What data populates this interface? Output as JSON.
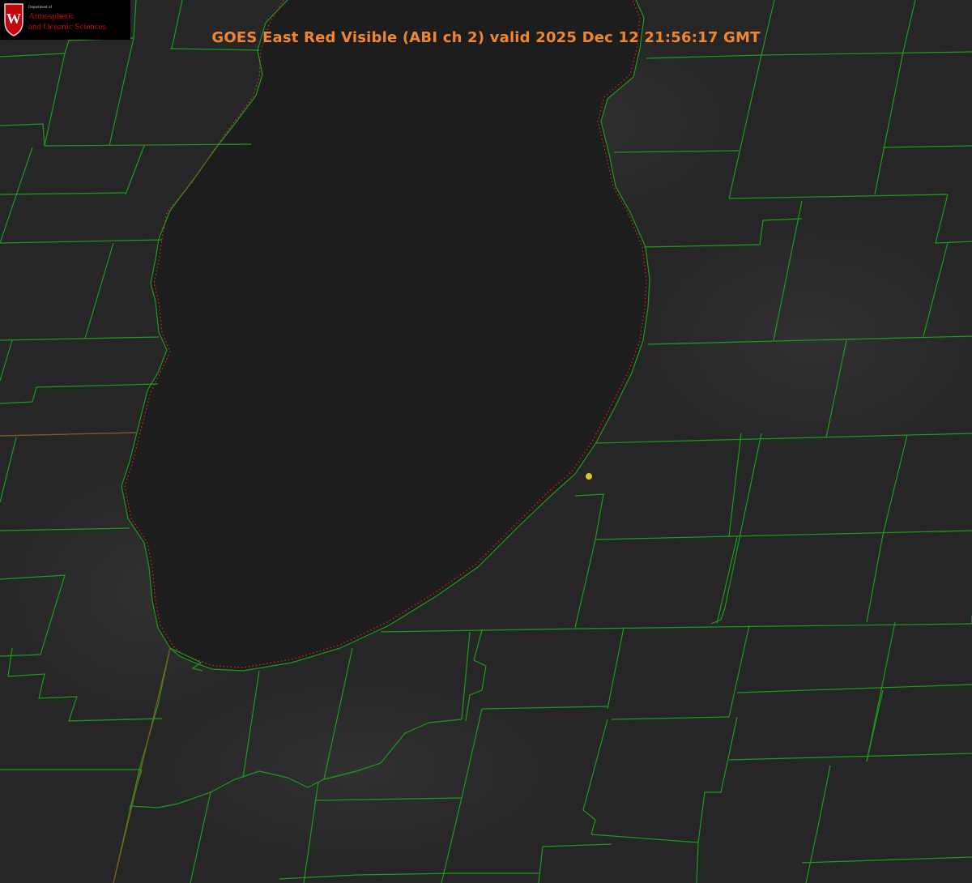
{
  "title": "GOES East Red Visible (ABI ch 2) valid 2025 Dec 12 21:56:17 GMT",
  "logo": {
    "seal_letter": "W",
    "department_of": "Department of",
    "name_line1": "Atmospheric",
    "name_line2": "and Oceanic Sciences"
  },
  "colors": {
    "background": "#262626",
    "lake": "#1d1d1d",
    "county_lines": "#1f9a1f",
    "lakeshore_dots": "#e0262b",
    "title": "#f0872e",
    "marker": "#d9c531",
    "logo_red": "#c5050c"
  },
  "marker": {
    "type": "station-dot",
    "color": "#d9c531"
  }
}
